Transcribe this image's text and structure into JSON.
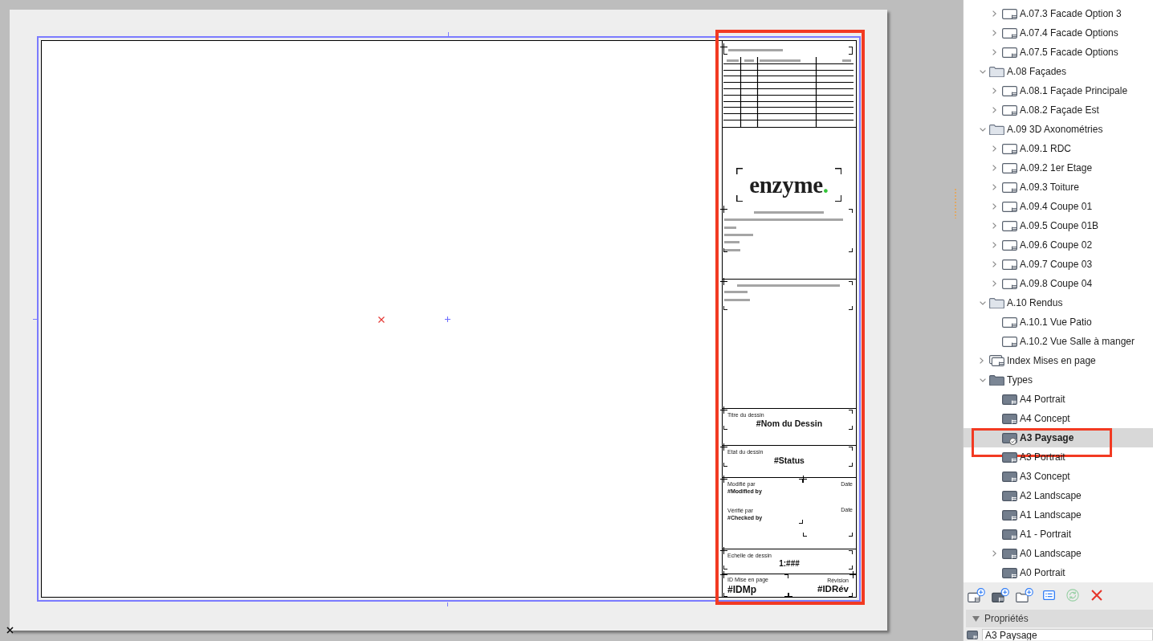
{
  "canvas": {
    "title_block": {
      "highlighted": true,
      "logo": {
        "text": "enzyme",
        "dot": "."
      },
      "drawing_title": {
        "label": "Titre du dessin",
        "value": "#Nom du Dessin"
      },
      "status": {
        "label": "Etat du dessin",
        "value": "#Status"
      },
      "signoffs": [
        {
          "label": "Modifié par",
          "value": "#Modified by",
          "date_label": "Date"
        },
        {
          "label": "Vérifié par",
          "value": "#Checked by",
          "date_label": "Date"
        }
      ],
      "scale": {
        "label": "Echelle de dessin",
        "value": "1:###"
      },
      "layout_id": {
        "label": "ID Mise en page",
        "value": "#IDMp"
      },
      "revision": {
        "label": "Révision",
        "value": "#IDRév"
      }
    }
  },
  "navigator": {
    "continued_items": [
      {
        "label": "A.07.3 Facade Option 3",
        "kind": "layout",
        "expanded": false,
        "selected": false
      },
      {
        "label": "A.07.4 Facade Options",
        "kind": "layout",
        "expanded": false,
        "selected": false
      },
      {
        "label": "A.07.5 Facade Options",
        "kind": "layout",
        "expanded": false,
        "selected": false
      }
    ],
    "items": [
      {
        "label": "A.08 Façades",
        "kind": "folder",
        "expanded": true,
        "selected": false,
        "children": [
          {
            "label": "A.08.1 Façade Principale",
            "kind": "layout",
            "expanded": false,
            "selected": false
          },
          {
            "label": "A.08.2 Façade Est",
            "kind": "layout",
            "expanded": false,
            "selected": false
          }
        ]
      },
      {
        "label": "A.09 3D Axonométries",
        "kind": "folder",
        "expanded": true,
        "selected": false,
        "children": [
          {
            "label": "A.09.1 RDC",
            "kind": "layout",
            "expanded": false,
            "selected": false
          },
          {
            "label": "A.09.2 1er Etage",
            "kind": "layout",
            "expanded": false,
            "selected": false
          },
          {
            "label": "A.09.3 Toiture",
            "kind": "layout",
            "expanded": false,
            "selected": false
          },
          {
            "label": "A.09.4 Coupe 01",
            "kind": "layout",
            "expanded": false,
            "selected": false
          },
          {
            "label": "A.09.5 Coupe 01B",
            "kind": "layout",
            "expanded": false,
            "selected": false
          },
          {
            "label": "A.09.6 Coupe 02",
            "kind": "layout",
            "expanded": false,
            "selected": false
          },
          {
            "label": "A.09.7 Coupe 03",
            "kind": "layout",
            "expanded": false,
            "selected": false
          },
          {
            "label": "A.09.8 Coupe 04",
            "kind": "layout",
            "expanded": false,
            "selected": false
          }
        ]
      },
      {
        "label": "A.10 Rendus",
        "kind": "folder",
        "expanded": true,
        "selected": false,
        "children": [
          {
            "label": "A.10.1 Vue Patio",
            "kind": "layout",
            "selected": false
          },
          {
            "label": "A.10.2 Vue Salle à manger",
            "kind": "layout",
            "selected": false
          }
        ]
      },
      {
        "label": "Index Mises en page",
        "kind": "index",
        "expanded": false,
        "selected": false
      },
      {
        "label": "Types",
        "kind": "master_folder",
        "expanded": true,
        "selected": false,
        "children": [
          {
            "label": "A4 Portrait",
            "kind": "master",
            "selected": false,
            "in_use": false,
            "highlighted": false
          },
          {
            "label": "A4 Concept",
            "kind": "master",
            "selected": false,
            "in_use": false,
            "highlighted": false
          },
          {
            "label": "A3 Paysage",
            "kind": "master",
            "selected": true,
            "in_use": true,
            "highlighted": true
          },
          {
            "label": "A3 Portrait",
            "kind": "master",
            "selected": false,
            "in_use": false,
            "highlighted": false
          },
          {
            "label": "A3 Concept",
            "kind": "master",
            "selected": false,
            "in_use": false,
            "highlighted": false
          },
          {
            "label": "A2 Landscape",
            "kind": "master",
            "selected": false,
            "in_use": false,
            "highlighted": false
          },
          {
            "label": "A1 Landscape",
            "kind": "master",
            "selected": false,
            "in_use": false,
            "highlighted": false
          },
          {
            "label": "A1 - Portrait",
            "kind": "master",
            "selected": false,
            "in_use": false,
            "highlighted": false
          },
          {
            "label": "A0 Landscape",
            "kind": "master",
            "expanded": false,
            "selected": false,
            "in_use": false,
            "highlighted": false
          },
          {
            "label": "A0 Portrait",
            "kind": "master",
            "selected": false,
            "in_use": false,
            "highlighted": false
          }
        ]
      }
    ],
    "toolbar": [
      {
        "kind": "new_layout",
        "disabled": false
      },
      {
        "kind": "new_master",
        "disabled": false
      },
      {
        "kind": "new_folder",
        "disabled": false
      },
      {
        "kind": "settings",
        "disabled": false
      },
      {
        "kind": "refresh",
        "disabled": true
      },
      {
        "kind": "delete",
        "disabled": false
      }
    ]
  },
  "properties": {
    "title": "Propriétés",
    "expanded": true,
    "name_value": "A3 Paysage"
  }
}
